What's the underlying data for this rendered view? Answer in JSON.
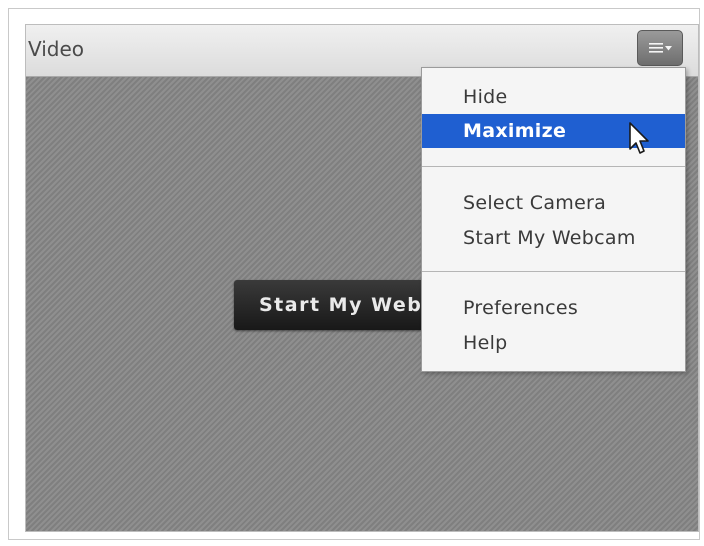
{
  "pod": {
    "title": "Video",
    "menu_icon": "hamburger-menu-icon"
  },
  "video": {
    "start_button_label": "Start My Webcam"
  },
  "menu": {
    "items": [
      {
        "label": "Hide"
      },
      {
        "label": "Maximize",
        "highlighted": true
      },
      {
        "label": "Select Camera"
      },
      {
        "label": "Start My Webcam"
      },
      {
        "label": "Preferences"
      },
      {
        "label": "Help"
      }
    ]
  },
  "colors": {
    "highlight": "#1f5fd1"
  }
}
